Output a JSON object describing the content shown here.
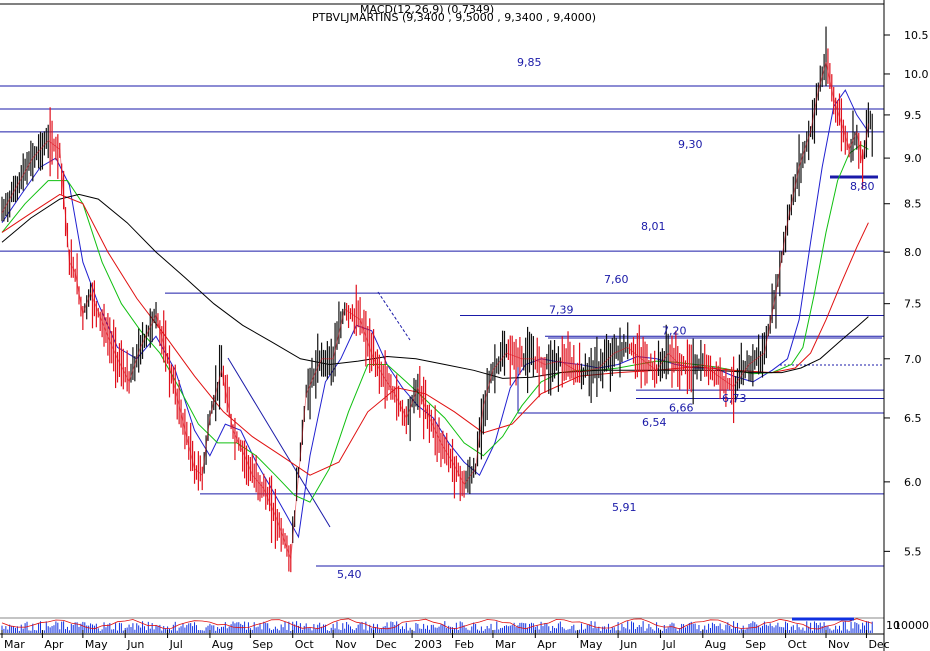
{
  "header": {
    "ticker_line": "PTBVLJMARTINS (9,3400 , 9,5000 , 9,3400 , 9,4000)",
    "overlap_line": "MACD(12,26,9) (0,7349)"
  },
  "colors": {
    "price_up": "#101010",
    "price_down": "#e0101c",
    "ma_short": "#2020d0",
    "ma_mid": "#10c010",
    "ma_long": "#e01010",
    "ma_very_long": "#000000",
    "level_line": "#1a1aa8",
    "volume": "#1030e0",
    "osc": "#e01010"
  },
  "chart_data": {
    "type": "line",
    "title": "",
    "scale": "log",
    "ylim": [
      5.3,
      10.85
    ],
    "y_ticks": [
      "10.5",
      "10.0",
      "9.5",
      "9.0",
      "8.5",
      "8.0",
      "7.5",
      "7.0",
      "6.5",
      "6.0",
      "5.5"
    ],
    "y_tick_values": [
      10.5,
      10.0,
      9.5,
      9.0,
      8.5,
      8.0,
      7.5,
      7.0,
      6.5,
      6.0,
      5.5
    ],
    "x_ticks": [
      "Mar",
      "Apr",
      "May",
      "Jun",
      "Jul",
      "Aug",
      "Sep",
      "Oct",
      "Nov",
      "Dec",
      "2003",
      "Feb",
      "Mar",
      "Apr",
      "May",
      "Jun",
      "Jul",
      "Aug",
      "Sep",
      "Oct",
      "Nov",
      "Dec"
    ],
    "x_tick_index": [
      0,
      21,
      42,
      64,
      86,
      108,
      129,
      151,
      172,
      193,
      213,
      234,
      255,
      277,
      299,
      320,
      342,
      364,
      385,
      407,
      428,
      449
    ],
    "x_max_index": 455,
    "volume_axis_label": "10000",
    "volume_axis_top": "10",
    "price_series": {
      "name": "PTBVLJMARTINS",
      "x": [
        0,
        8,
        16,
        24,
        30,
        35,
        38,
        42,
        46,
        55,
        60,
        66,
        72,
        80,
        86,
        92,
        100,
        104,
        108,
        114,
        120,
        126,
        130,
        136,
        142,
        150,
        158,
        166,
        172,
        178,
        186,
        193,
        198,
        204,
        210,
        216,
        222,
        228,
        234,
        240,
        246,
        250,
        255,
        262,
        270,
        276,
        282,
        290,
        300,
        310,
        318,
        325,
        332,
        340,
        346,
        352,
        358,
        364,
        372,
        380,
        388,
        396,
        402,
        408,
        414,
        420,
        424,
        428,
        432,
        436,
        440,
        444,
        447,
        450
      ],
      "y": [
        8.4,
        8.7,
        9.0,
        9.2,
        9.1,
        7.9,
        7.8,
        7.4,
        7.6,
        7.2,
        7.0,
        6.8,
        7.1,
        7.4,
        7.0,
        6.6,
        6.1,
        6.05,
        6.5,
        6.9,
        6.4,
        6.2,
        6.05,
        5.95,
        5.75,
        5.45,
        6.7,
        7.0,
        7.0,
        7.45,
        7.35,
        7.0,
        6.85,
        6.7,
        6.5,
        6.75,
        6.5,
        6.3,
        6.15,
        5.98,
        6.1,
        6.6,
        6.9,
        7.05,
        7.0,
        7.0,
        6.95,
        6.98,
        6.88,
        6.92,
        7.05,
        7.1,
        7.0,
        6.9,
        7.05,
        6.95,
        6.92,
        6.95,
        6.85,
        6.76,
        6.95,
        7.05,
        7.6,
        8.3,
        8.9,
        9.3,
        9.8,
        10.15,
        9.7,
        9.4,
        9.1,
        9.3,
        8.95,
        9.4
      ]
    },
    "ma_series": [
      {
        "key": "ma_short",
        "x": [
          0,
          10,
          20,
          28,
          35,
          42,
          50,
          60,
          70,
          80,
          90,
          100,
          108,
          116,
          124,
          132,
          140,
          148,
          154,
          160,
          168,
          176,
          184,
          192,
          200,
          208,
          216,
          224,
          232,
          240,
          248,
          256,
          264,
          272,
          280,
          290,
          300,
          310,
          320,
          330,
          340,
          350,
          360,
          370,
          380,
          390,
          400,
          408,
          414,
          420,
          426,
          432,
          438,
          444,
          450
        ],
        "y": [
          8.3,
          8.6,
          8.9,
          9.0,
          8.7,
          7.9,
          7.5,
          7.1,
          7.0,
          7.2,
          6.9,
          6.4,
          6.2,
          6.45,
          6.4,
          6.15,
          5.95,
          5.75,
          5.6,
          6.2,
          6.8,
          7.0,
          7.3,
          7.25,
          6.95,
          6.75,
          6.6,
          6.5,
          6.3,
          6.15,
          6.05,
          6.3,
          6.75,
          6.95,
          7.0,
          6.97,
          6.95,
          6.92,
          6.95,
          7.02,
          7.0,
          6.95,
          6.92,
          6.92,
          6.85,
          6.8,
          6.9,
          7.0,
          7.35,
          8.1,
          8.9,
          9.6,
          9.8,
          9.5,
          9.3
        ]
      },
      {
        "key": "ma_mid",
        "x": [
          0,
          12,
          24,
          34,
          42,
          52,
          62,
          72,
          82,
          92,
          102,
          112,
          122,
          132,
          142,
          152,
          160,
          170,
          180,
          190,
          200,
          210,
          220,
          230,
          240,
          250,
          260,
          270,
          280,
          290,
          300,
          310,
          320,
          330,
          340,
          350,
          360,
          370,
          380,
          390,
          400,
          410,
          416,
          422,
          428,
          434,
          440,
          446,
          450
        ],
        "y": [
          8.2,
          8.5,
          8.75,
          8.75,
          8.5,
          7.9,
          7.5,
          7.25,
          7.05,
          6.75,
          6.45,
          6.3,
          6.3,
          6.2,
          6.05,
          5.9,
          5.85,
          6.1,
          6.55,
          6.95,
          6.95,
          6.8,
          6.65,
          6.5,
          6.3,
          6.2,
          6.35,
          6.6,
          6.8,
          6.88,
          6.9,
          6.9,
          6.92,
          6.95,
          6.98,
          6.97,
          6.95,
          6.93,
          6.9,
          6.87,
          6.88,
          6.95,
          7.1,
          7.6,
          8.2,
          8.75,
          9.05,
          9.15,
          9.1
        ]
      },
      {
        "key": "ma_long",
        "x": [
          0,
          15,
          30,
          42,
          55,
          70,
          85,
          100,
          115,
          130,
          145,
          160,
          175,
          190,
          205,
          220,
          235,
          250,
          265,
          280,
          300,
          320,
          340,
          360,
          380,
          400,
          412,
          420,
          428,
          436,
          444,
          450
        ],
        "y": [
          8.2,
          8.4,
          8.6,
          8.5,
          8.0,
          7.55,
          7.2,
          6.85,
          6.55,
          6.35,
          6.2,
          6.05,
          6.15,
          6.55,
          6.75,
          6.7,
          6.55,
          6.38,
          6.45,
          6.7,
          6.85,
          6.88,
          6.9,
          6.93,
          6.9,
          6.88,
          6.92,
          7.05,
          7.35,
          7.7,
          8.05,
          8.3
        ]
      },
      {
        "key": "ma_very_long",
        "x": [
          0,
          15,
          30,
          40,
          50,
          65,
          80,
          95,
          110,
          125,
          140,
          155,
          170,
          185,
          200,
          215,
          230,
          245,
          260,
          275,
          290,
          310,
          330,
          350,
          370,
          390,
          405,
          415,
          425,
          435,
          445,
          450
        ],
        "y": [
          8.1,
          8.35,
          8.55,
          8.6,
          8.55,
          8.3,
          8.0,
          7.75,
          7.5,
          7.3,
          7.15,
          7.0,
          6.95,
          6.98,
          7.02,
          7.0,
          6.95,
          6.9,
          6.83,
          6.84,
          6.88,
          6.9,
          6.9,
          6.9,
          6.9,
          6.88,
          6.88,
          6.92,
          7.0,
          7.15,
          7.3,
          7.38
        ]
      }
    ],
    "horizontal_levels": [
      {
        "label": "9,85",
        "value": 9.85
      },
      {
        "label": "9,30",
        "value": 9.3
      },
      {
        "label": "8,80",
        "value": 8.8
      },
      {
        "label": "8,01",
        "value": 8.01
      },
      {
        "label": "7,60",
        "value": 7.6
      },
      {
        "label": "7,39",
        "value": 7.39
      },
      {
        "label": "7,20",
        "value": 7.2
      },
      {
        "label": "6,73",
        "value": 6.73
      },
      {
        "label": "6,66",
        "value": 6.66
      },
      {
        "label": "6,54",
        "value": 6.54
      },
      {
        "label": "5,91",
        "value": 5.91
      },
      {
        "label": "5,40",
        "value": 5.4
      }
    ],
    "annotations": [
      "9,85",
      "9,30",
      "8,80",
      "8,01",
      "7,60",
      "7,39",
      "7,20",
      "6,73",
      "6,66",
      "6,54",
      "5,91",
      "5,40"
    ]
  }
}
